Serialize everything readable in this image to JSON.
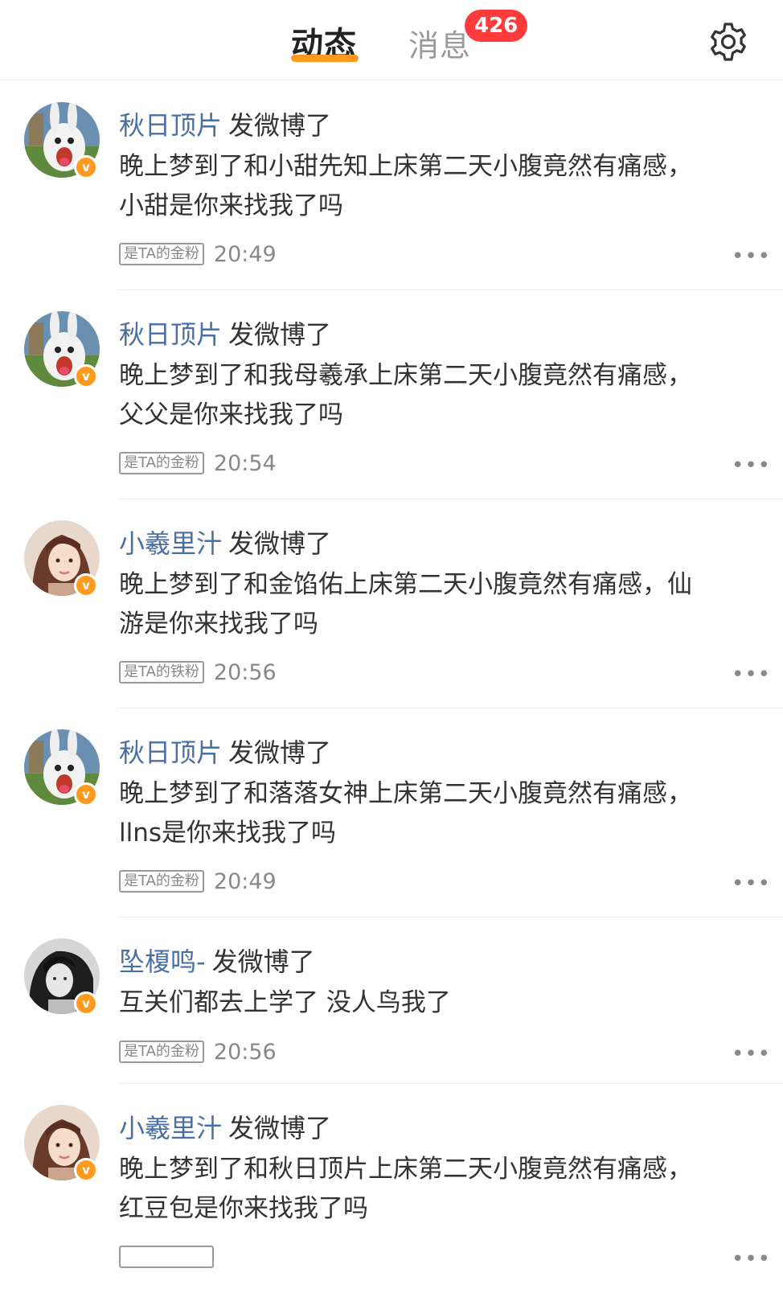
{
  "header": {
    "tab_active": "动态",
    "tab_inactive": "消息",
    "badge": "426",
    "accent": "#ff9a1f",
    "badge_color": "#ff3b3b"
  },
  "feed": [
    {
      "avatar": "rabbid-avatar",
      "username": "秋日顶片",
      "action": "发微博了",
      "content": "晚上梦到了和小甜先知上床第二天小腹竟然有痛感，小甜是你来找我了吗",
      "fan_tag": "是TA的金粉",
      "time": "20:49"
    },
    {
      "avatar": "rabbid-avatar",
      "username": "秋日顶片",
      "action": "发微博了",
      "content": "晚上梦到了和我母羲承上床第二天小腹竟然有痛感，父父是你来找我了吗",
      "fan_tag": "是TA的金粉",
      "time": "20:54"
    },
    {
      "avatar": "girl-avatar",
      "username": "小羲里汁",
      "action": "发微博了",
      "content": "晚上梦到了和金馅佑上床第二天小腹竟然有痛感，仙游是你来找我了吗",
      "fan_tag": "是TA的铁粉",
      "time": "20:56"
    },
    {
      "avatar": "rabbid-avatar",
      "username": "秋日顶片",
      "action": "发微博了",
      "content": "晚上梦到了和落落女神上床第二天小腹竟然有痛感，llns是你来找我了吗",
      "fan_tag": "是TA的金粉",
      "time": "20:49"
    },
    {
      "avatar": "bw-girl-avatar",
      "username": "坠榎鸣-",
      "action": "发微博了",
      "content": "互关们都去上学了 没人鸟我了",
      "fan_tag": "是TA的金粉",
      "time": "20:56"
    },
    {
      "avatar": "girl-avatar",
      "username": "小羲里汁",
      "action": "发微博了",
      "content": "晚上梦到了和秋日顶片上床第二天小腹竟然有痛感，红豆包是你来找我了吗",
      "fan_tag": "",
      "time": ""
    }
  ],
  "icons": {
    "settings": "gear-icon",
    "more": "more-icon",
    "verified": "verified-badge-icon"
  }
}
